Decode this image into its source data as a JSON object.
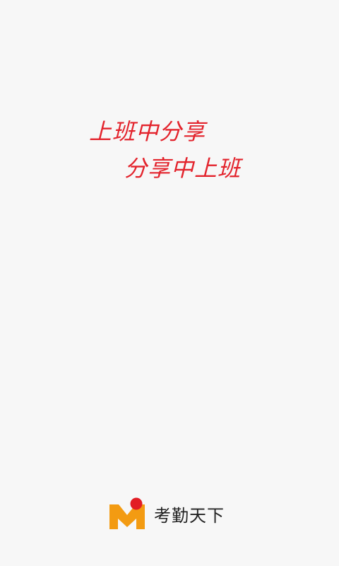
{
  "splash": {
    "slogan_line1": "上班中分享",
    "slogan_line2": "分享中上班"
  },
  "brand": {
    "name": "考勤天下",
    "logo_icon": "brand-m-logo-icon"
  },
  "colors": {
    "background": "#f7f7f7",
    "slogan": "#e3232c",
    "logo_orange": "#f39b12",
    "logo_red": "#e21d24",
    "brand_text": "#222222"
  }
}
